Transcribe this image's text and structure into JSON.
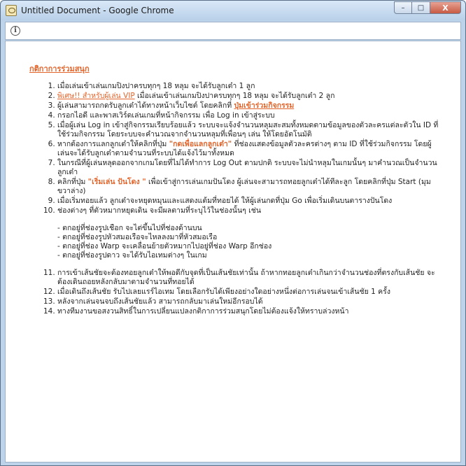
{
  "window": {
    "title": "Untitled Document - Google Chrome",
    "minimize_label": "–",
    "maximize_label": "□",
    "close_label": "X"
  },
  "heading": "กติกาการร่วมสนุก",
  "rules": {
    "r1": "เมื่อเล่นเข้าเล่นเกมปิงปาครบทุกๆ 18 หลุม จะได้รับลูกเต๋า 1 ลูก",
    "r2_vip": "พิเศษ!! สำหรับผู้เล่น VIP",
    "r2_rest": " เมื่อเล่นเข้าเล่นเกมปิงปาครบทุกๆ 18 หลุม จะได้รับลูกเต๋า 2 ลูก",
    "r3_text": "ผู้เล่นสามารถกดรับลูกเต๋าได้ทางหน้าเว็บไซต์ โดยคลิกที่ ",
    "r3_link": "ปุ่มเข้าร่วมกิจกรรม",
    "r4": "กรอกไอดี และพาสเวิร์ดเล่นเกมที่หน้ากิจกรรม เพื่อ Log in เข้าสู่ระบบ",
    "r5": "เมื่อผู้เล่น Log in เข้าสู่กิจกรรมเรียบร้อยแล้ว ระบบจะแจ้งจำนวนหลุมสะสมทั้งหมดตามข้อมูลของตัวละครแต่ละตัวใน ID ที่ใช้ร่วมกิจกรรม โดยระบบจะคำนวณจากจำนวนหลุมที่เพื่อนๆ เล่น ให้โดยอัตโนมัติ",
    "r6_pre": "หากต้องการแลกลูกเต๋าให้คลิกที่ปุ่ม ",
    "r6_accent": "\"กดเพื่อแลกลูกเต๋า\"",
    "r6_post": " ที่ช่องแสดงข้อมูลตัวละครต่างๆ ตาม ID ที่ใช้ร่วมกิจกรรม โดยผู้เล่นจะได้รับลูกเต๋าตามจำนวนที่ระบบได้แจ้งไว้มาทั้งหมด",
    "r7": "ในกรณีที่ผู้เล่นหลุดออกจากเกมโดยที่ไม่ได้ทำการ Log Out ตามปกติ ระบบจะไม่นำหลุมในเกมนั้นๆ มาคำนวณเป็นจำนวนลูกเต๋า",
    "r8_pre": "คลิกที่ปุ่ม ",
    "r8_accent": "\"เริ่มเล่น ปันโดง \"",
    "r8_post": " เพื่อเข้าสู่การเล่นเกมปันโดง ผู้เล่นจะสามารถทอยลูกเต๋าได้ทีละลูก โดยคลิกที่ปุ่ม Start (มุมขวาล่าง)",
    "r9": "เมื่อเริ่มทอยแล้ว ลูกเต๋าจะหยุดหมุนและแสดงแต้มที่ทอยได้ ให้ผู้เล่นกดที่ปุ่ม Go เพื่อเริ่มเดินบนตารางปันโดง",
    "r10": "ช่องต่างๆ ที่ตัวหมากหยุดเดิน จะมีผลตามที่ระบุไว้ในช่องนั้นๆ เช่น",
    "sub1": "- ตกอยู่ที่ช่องรูปเชือก จะไต่ขึ้นไปที่ช่องด้านบน",
    "sub2": "- ตกอยู่ที่ช่องรูปหัวสมอเรือจะไหลลงมาที่หัวสมอเรือ",
    "sub3": "- ตกอยู่ที่ช่อง Warp จะเคลื่อนย้ายตัวหมากไปอยู่ที่ช่อง Warp อีกช่อง",
    "sub4": "- ตกอยู่ที่ช่องรูปดาว จะได้รับไอเทมต่างๆ ในเกม",
    "r11": "การเข้าเส้นชัยจะต้องทอยลูกเต๋าให้พอดีกับจุดที่เป็นเส้นชัยเท่านั้น ถ้าหากทอยลูกเต๋าเกินกว่าจำนวนช่องที่ตรงกับเส้นชัย จะต้องเดินถอยหลังกลับมาตามจำนวนที่ทอยได้",
    "r12": "เมื่อเดินถึงเส้นชัย รับไปเลยแรร์ไอเทม โดยเลือกรับได้เพียงอย่างใดอย่างหนึ่งต่อการเล่นจนเข้าเส้นชัย 1 ครั้ง",
    "r13": "หลังจากเล่นจนจบถึงเส้นชัยแล้ว สามารถกลับมาเล่นใหม่อีกรอบได้",
    "r14": "ทางทีมงานขอสงวนสิทธิ์ในการเปลี่ยนแปลงกติกาการร่วมสนุกโดยไม่ต้องแจ้งให้ทราบล่วงหน้า"
  }
}
